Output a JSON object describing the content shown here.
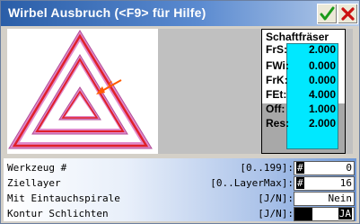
{
  "window": {
    "title": "Wirbel Ausbruch (<F9> für Hilfe)"
  },
  "titlebar_buttons": {
    "ok_icon": "green-checkmark",
    "close_icon": "red-x"
  },
  "preview": {
    "shape": "triangle-pocket-spiral"
  },
  "tool_panel": {
    "title": "Schaftfräser",
    "rows": [
      {
        "label": "FrS:",
        "value": "2.000"
      },
      {
        "label": "FWi:",
        "value": "0.000"
      },
      {
        "label": "FrK:",
        "value": "0.000"
      },
      {
        "label": "FEt:",
        "value": "4.000"
      },
      {
        "label": "Off:",
        "value": "1.000"
      },
      {
        "label": "Res:",
        "value": "2.000"
      }
    ]
  },
  "form": {
    "fields": [
      {
        "label": "Werkzeug #",
        "range": "[0..199]:",
        "prefix": "#",
        "value": "0"
      },
      {
        "label": "Ziellayer",
        "range": "[0..LayerMax]:",
        "prefix": "#",
        "value": "16"
      },
      {
        "label": "Mit Eintauchspirale",
        "range": "[J/N]:",
        "value": "Nein"
      },
      {
        "label": "Kontur Schlichten",
        "range": "[J/N]:",
        "value": "JA"
      }
    ]
  },
  "colors": {
    "title_gradient_start": "#2a5ea8",
    "cyan_bar": "#00e8ff",
    "contour_red": "#e0202a",
    "contour_pink": "#e08acb"
  }
}
